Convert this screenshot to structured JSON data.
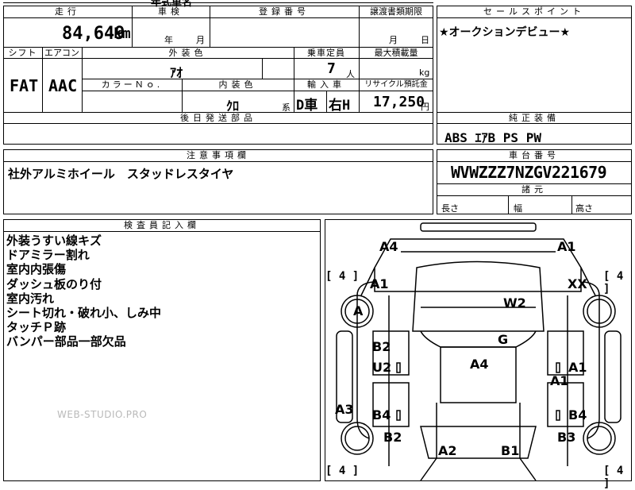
{
  "top_fragment": "年式車名",
  "headers": {
    "mileage": "走行",
    "inspection": "車検",
    "registration": "登録番号",
    "transfer_deadline": "譲渡書類期限",
    "sales_point": "セールスポイント",
    "shift": "シフト",
    "aircon": "エアコン",
    "exterior_color": "外装色",
    "capacity": "乗車定員",
    "max_load": "最大積載量",
    "color_no": "カラーＮｏ.",
    "interior_color": "内装色",
    "import": "輸入車",
    "recycle": "リサイクル預託金",
    "later_parts": "後日発送部品",
    "equipment": "純正装備",
    "caution": "注意事項欄",
    "chassis": "車台番号",
    "dimensions": "諸元",
    "inspector": "検査員記入欄"
  },
  "values": {
    "mileage": "84,649",
    "mileage_unit": "km",
    "inspection_year": "年",
    "inspection_month": "月",
    "transfer_month": "月",
    "transfer_day": "日",
    "sales_point": "★オークションデビュー★",
    "shift": "FAT",
    "aircon": "AAC",
    "exterior_color": "ｱｵ",
    "capacity": "7",
    "capacity_unit": "人",
    "load_unit": "kg",
    "interior_color": "ｸﾛ",
    "interior_suffix": "系",
    "import_d": "D車",
    "import_h": "右H",
    "recycle": "17,250",
    "recycle_unit": "円",
    "equipment": "ABS ｴｱB PS PW",
    "caution": "社外アルミホイール　スタッドレスタイヤ",
    "chassis": "WVWZZZ7NZGV221679",
    "length": "長さ",
    "width": "幅",
    "height": "高さ"
  },
  "inspector_notes": [
    "外装うすい線キズ",
    "ドアミラー割れ",
    "室内内張傷",
    "ダッシュ板のり付",
    "室内汚れ",
    "シート切れ・破れ小、しみ中",
    "タッチＰ跡",
    "バンパー部品一部欠品"
  ],
  "watermark": "WEB-STUDIO.PRO",
  "diagram": {
    "tire_count": "4",
    "labels": {
      "front_left_corner": "A4",
      "front_right_corner": "A1",
      "left_fender": "A1",
      "right_fender": "XX",
      "left_front_wheel": "A",
      "windshield": "W2",
      "roof": "G",
      "left_front_door": "B2",
      "left_rear_door_upper": "U2",
      "roof_center": "A4",
      "right_front_door": "A1",
      "right_door_mid": "A1",
      "left_sill": "A3",
      "left_rear_door": "B4",
      "right_rear_door": "B4",
      "left_rear_quarter": "B2",
      "right_rear_quarter": "B3",
      "rear_left": "A2",
      "rear_right": "B1"
    }
  }
}
